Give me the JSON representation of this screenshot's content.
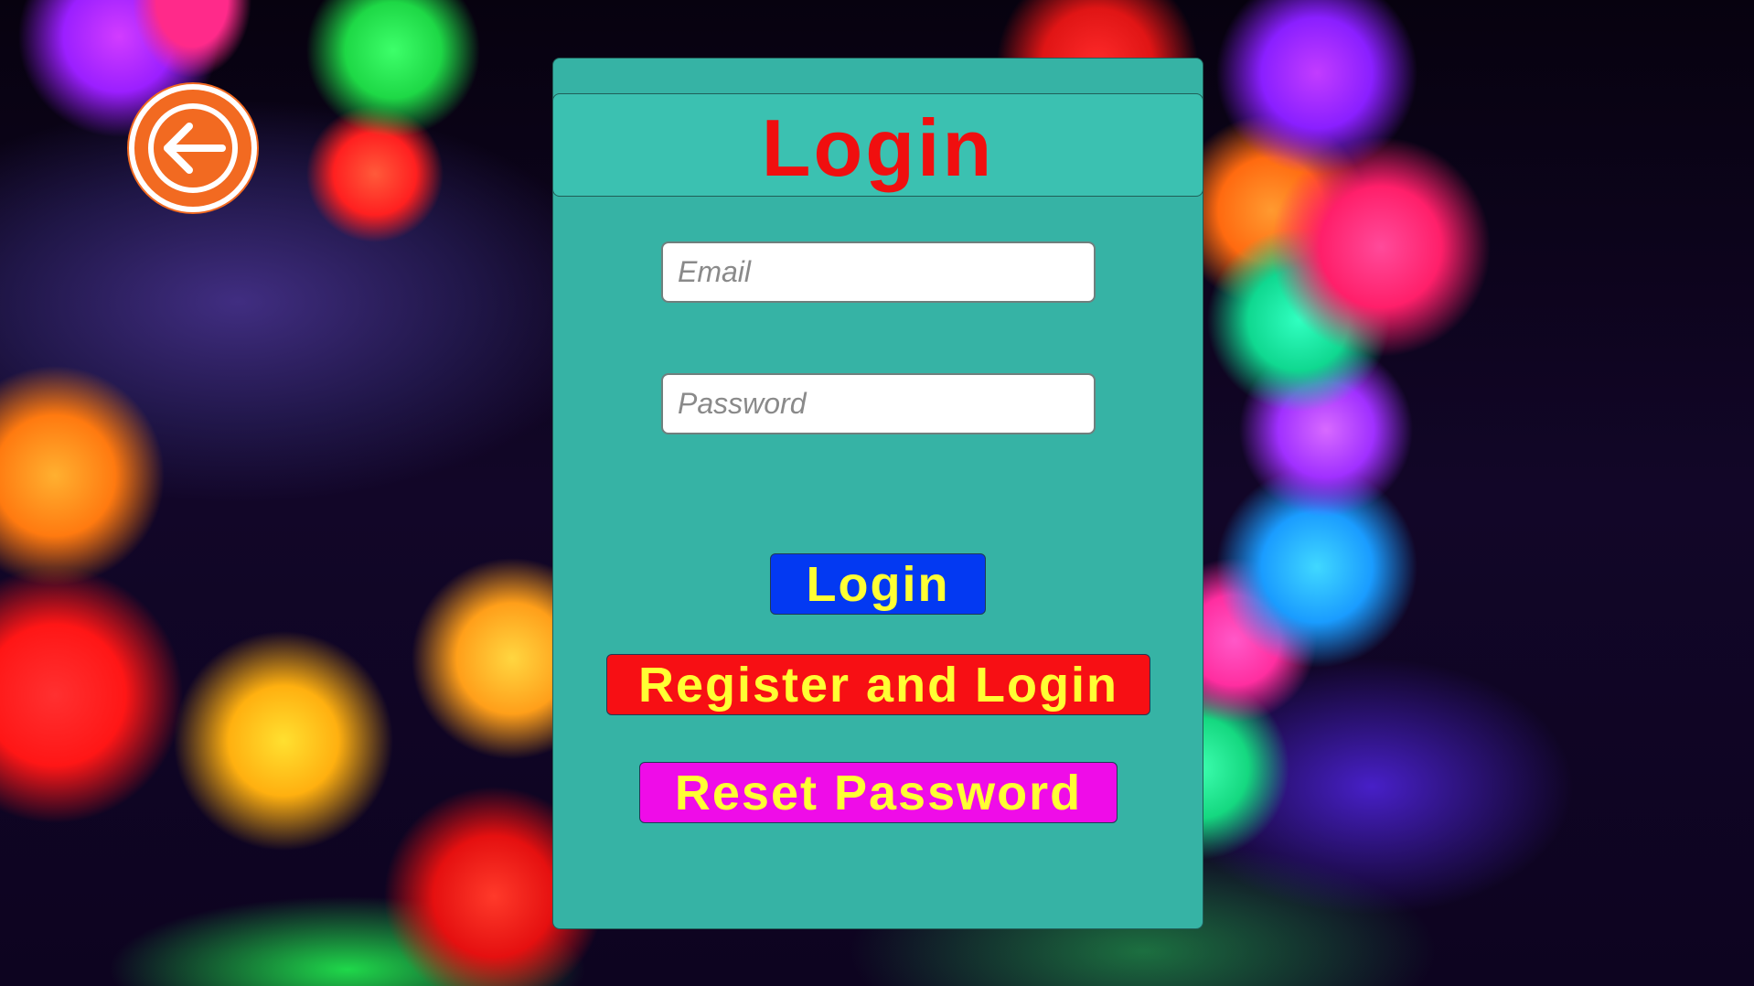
{
  "back_button": {
    "icon": "arrow-left-icon",
    "color": "#f26a21"
  },
  "login_panel": {
    "title": "Login",
    "title_color": "#f00f0f",
    "background": "#36b3a5",
    "email": {
      "placeholder": "Email",
      "value": ""
    },
    "password": {
      "placeholder": "Password",
      "value": ""
    },
    "buttons": {
      "login_label": "Login",
      "login_color": "#0339f2",
      "register_label": "Register and Login",
      "register_color": "#f70f14",
      "reset_label": "Reset Password",
      "reset_color": "#ef0ce8",
      "text_color": "#ffff33"
    }
  }
}
